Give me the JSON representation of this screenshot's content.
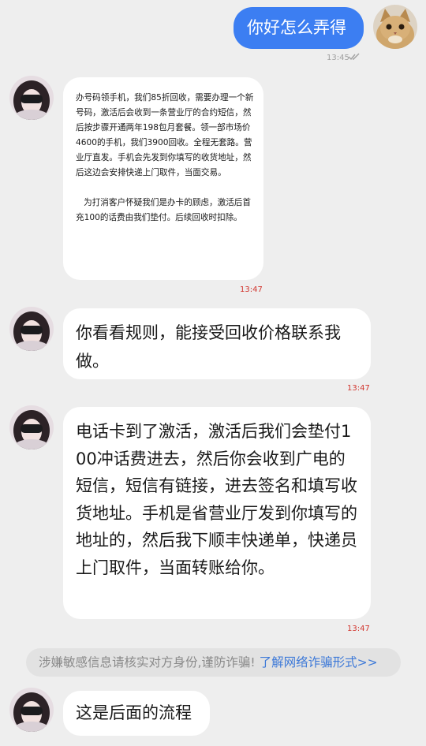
{
  "messages": {
    "outgoing": {
      "text": "你好怎么弄得",
      "time": "13:45"
    },
    "incoming": [
      {
        "text": "办号码领手机，我们85折回收，需要办理一个新号码，激活后会收到一条营业厅的合约短信，然后按步骤开通两年198包月套餐。领一部市场价4600的手机，我们3900回收。全程无套路。营业厅直发。手机会先发到你填写的收货地址，然后这边会安排快递上门取件，当面交易。\n\n   为打消客户怀疑我们是办卡的顾虑，激活后首充100的话费由我们垫付。后续回收时扣除。",
        "time": "13:47"
      },
      {
        "text": "你看看规则，能接受回收价格联系我做。",
        "time": "13:47"
      },
      {
        "text": "电话卡到了激活，激活后我们会垫付100冲话费进去，然后你会收到广电的短信，短信有链接，进去签名和填写收货地址。手机是省营业厅发到你填写的地址的，然后我下顺丰快递单，快递员上门取件，当面转账给你。",
        "time": "13:47"
      },
      {
        "text": "这是后面的流程",
        "time": ""
      }
    ]
  },
  "warning": {
    "text": "涉嫌敏感信息请核实对方身份,谨防诈骗!",
    "link": "了解网络诈骗形式>>"
  },
  "colors": {
    "outgoing_bubble": "#3c7ef2",
    "incoming_bubble": "#ffffff",
    "background": "#eeeeee",
    "incoming_time": "#d2352e",
    "warning_link": "#3d79d8"
  },
  "icons": {
    "read_receipt": "double-check-icon",
    "self_avatar": "cat-avatar",
    "contact_avatar": "contact-avatar"
  }
}
